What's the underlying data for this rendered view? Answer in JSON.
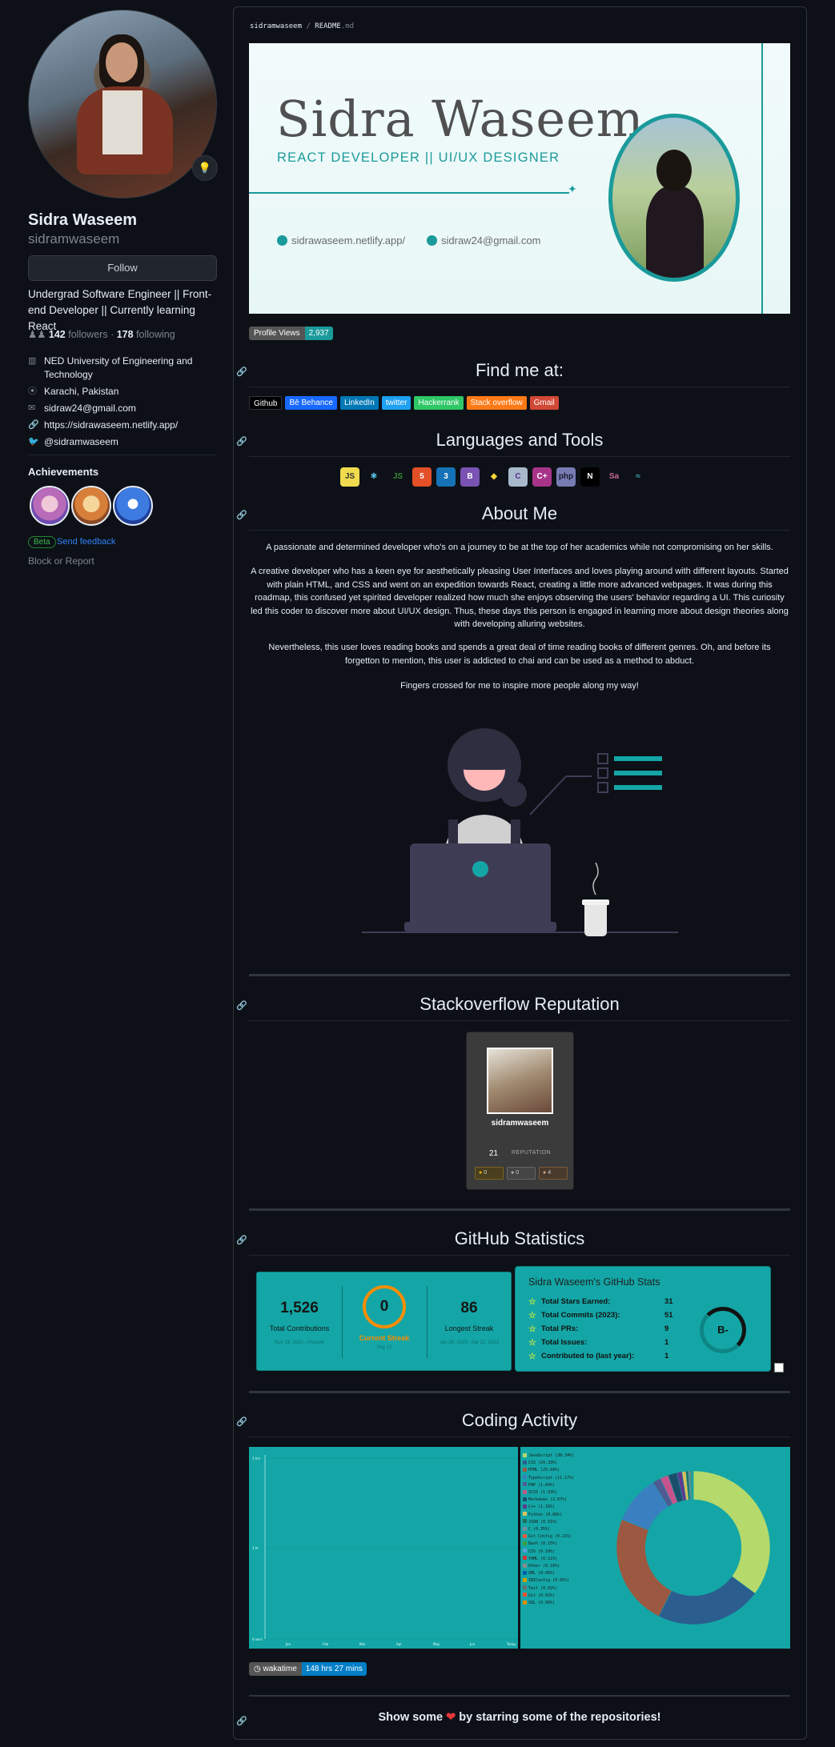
{
  "profile": {
    "name": "Sidra Waseem",
    "login": "sidramwaseem",
    "status_emoji": "💡",
    "follow_label": "Follow",
    "bio": "Undergrad Software Engineer || Front-end Developer || Currently learning React",
    "followers": "142",
    "followers_label": "followers",
    "following": "178",
    "following_label": "following",
    "separator": "·",
    "info": [
      {
        "icon": "building-icon",
        "glyph": "▥",
        "text": "NED University of Engineering and Technology"
      },
      {
        "icon": "location-icon",
        "glyph": "⦿",
        "text": "Karachi, Pakistan"
      },
      {
        "icon": "mail-icon",
        "glyph": "✉",
        "text": "sidraw24@gmail.com"
      },
      {
        "icon": "link-icon",
        "glyph": "🔗",
        "text": "https://sidrawaseem.netlify.app/"
      },
      {
        "icon": "twitter-icon",
        "glyph": "🐦",
        "text": "@sidramwaseem"
      }
    ],
    "achievements_title": "Achievements",
    "beta_label": "Beta",
    "feedback_label": "Send feedback",
    "block_label": "Block or Report"
  },
  "readme": {
    "path_user": "sidramwaseem",
    "path_sep": "/",
    "path_file": "README",
    "path_ext": ".md",
    "banner": {
      "name": "Sidra Waseem",
      "role": "REACT DEVELOPER || UI/UX DESIGNER",
      "website": "sidrawaseem.netlify.app/",
      "email": "sidraw24@gmail.com"
    },
    "views_label": "Profile Views",
    "views_value": "2,937",
    "find_me": "Find me at:",
    "socials": [
      {
        "label": "Github",
        "color": "#000000",
        "icon": "github-icon"
      },
      {
        "label": "Bē Behance",
        "color": "#1769ff",
        "icon": "behance-icon"
      },
      {
        "label": "LinkedIn",
        "color": "#0077b5",
        "icon": "linkedin-icon"
      },
      {
        "label": "twitter",
        "color": "#1da1f2",
        "icon": "twitter-icon"
      },
      {
        "label": "Hackerrank",
        "color": "#2ec866",
        "icon": "hackerrank-icon"
      },
      {
        "label": "Stack overflow",
        "color": "#fe7a16",
        "icon": "stackoverflow-icon"
      },
      {
        "label": "Gmail",
        "color": "#d14836",
        "icon": "gmail-icon"
      }
    ],
    "languages_title": "Languages and Tools",
    "tools": [
      {
        "icon": "javascript-icon",
        "glyph": "JS",
        "bg": "#f0db4f",
        "fg": "#323330"
      },
      {
        "icon": "react-icon",
        "glyph": "⚛",
        "bg": "#0d1117",
        "fg": "#61dafb"
      },
      {
        "icon": "nodejs-icon",
        "glyph": "JS",
        "bg": "#0d1117",
        "fg": "#3c873a"
      },
      {
        "icon": "html5-icon",
        "glyph": "5",
        "bg": "#e34f26",
        "fg": "#ffffff"
      },
      {
        "icon": "css3-icon",
        "glyph": "3",
        "bg": "#1572b6",
        "fg": "#ffffff"
      },
      {
        "icon": "bootstrap-icon",
        "glyph": "B",
        "bg": "#7952b3",
        "fg": "#ffffff"
      },
      {
        "icon": "python-icon",
        "glyph": "◆",
        "bg": "#0d1117",
        "fg": "#ffd43b"
      },
      {
        "icon": "c-icon",
        "glyph": "C",
        "bg": "#a8b9cc",
        "fg": "#5c2d91"
      },
      {
        "icon": "cplusplus-icon",
        "glyph": "C+",
        "bg": "#a8348a",
        "fg": "#ffffff"
      },
      {
        "icon": "php-icon",
        "glyph": "php",
        "bg": "#777bb4",
        "fg": "#1a1a2e"
      },
      {
        "icon": "nextjs-icon",
        "glyph": "N",
        "bg": "#000000",
        "fg": "#ffffff"
      },
      {
        "icon": "sass-icon",
        "glyph": "Sa",
        "bg": "#0d1117",
        "fg": "#cc6699"
      },
      {
        "icon": "tailwind-icon",
        "glyph": "≈",
        "bg": "#0d1117",
        "fg": "#38b2ac"
      }
    ],
    "about_title": "About Me",
    "about": [
      "A passionate and determined developer who's on a journey to be at the top of her academics while not compromising on her skills.",
      "A creative developer who has a keen eye for aesthetically pleasing User Interfaces and loves playing around with different layouts. Started with plain HTML, and CSS and went on an expedition towards React, creating a little more advanced webpages. It was during this roadmap, this confused yet spirited developer realized how much she enjoys observing the users' behavior regarding a UI. This curiosity led this coder to discover more about UI/UX design. Thus, these days this person is engaged in learning more about design theories along with developing alluring websites.",
      "Nevertheless, this user loves reading books and spends a great deal of time reading books of different genres. Oh, and before its forgetton to mention, this user is addicted to chai and can be used as a method to abduct.",
      "Fingers crossed for me to inspire more people along my way!"
    ],
    "stackoverflow_title": "Stackoverflow Reputation",
    "stackoverflow": {
      "user": "sidramwaseem",
      "reputation": "21",
      "reputation_label": "REPUTATION",
      "gold": "0",
      "silver": "0",
      "bronze": "4",
      "badge_glyph": "●"
    },
    "github_title": "GitHub Statistics",
    "streak": {
      "total": "1,526",
      "total_label": "Total Contributions",
      "total_range": "Nov 15, 2020 - Present",
      "current": "0",
      "current_label": "Current Streak",
      "current_range": "Sep 12",
      "longest": "86",
      "longest_label": "Longest Streak",
      "longest_range": "Jan 26, 2023 - Apr 21, 2023"
    },
    "gh_stats": {
      "title": "Sidra Waseem's GitHub Stats",
      "rows": [
        {
          "label": "Total Stars Earned:",
          "value": "31"
        },
        {
          "label": "Total Commits (2023):",
          "value": "51"
        },
        {
          "label": "Total PRs:",
          "value": "9"
        },
        {
          "label": "Total Issues:",
          "value": "1"
        },
        {
          "label": "Contributed to (last year):",
          "value": "1"
        }
      ],
      "grade": "B-",
      "grade_progress": 0.3
    },
    "coding_title": "Coding Activity",
    "coding_chart": {
      "y_ticks": [
        "1 hrs",
        "1 hr",
        "0 secs"
      ],
      "x_ticks": [
        "Jan",
        "Feb",
        "Mar",
        "Apr",
        "May",
        "Jun",
        "Today"
      ]
    },
    "languages_legend": [
      {
        "label": "JavaScript (38.34%)",
        "value": 38.34,
        "color": "#b5d96a"
      },
      {
        "label": "CSS (24.33%)",
        "value": 24.33,
        "color": "#2b5d8f"
      },
      {
        "label": "HTML (25.69%)",
        "value": 25.69,
        "color": "#9c5840"
      },
      {
        "label": "TypeScript (11.17%)",
        "value": 11.17,
        "color": "#3a7fbf"
      },
      {
        "label": "PHP (1.84%)",
        "value": 1.84,
        "color": "#4f5b93"
      },
      {
        "label": "SCSS (1.93%)",
        "value": 1.93,
        "color": "#c6538c"
      },
      {
        "label": "Markdown (2.07%)",
        "value": 2.07,
        "color": "#1a4f6b"
      },
      {
        "label": "C++ (1.16%)",
        "value": 1.16,
        "color": "#5e3a8f"
      },
      {
        "label": "Python (0.89%)",
        "value": 0.89,
        "color": "#d9c15b"
      },
      {
        "label": "JSON (0.51%)",
        "value": 0.51,
        "color": "#1f6e5e"
      },
      {
        "label": "C (0.35%)",
        "value": 0.35,
        "color": "#7a8b9c"
      },
      {
        "label": "Git Config (0.21%)",
        "value": 0.21,
        "color": "#e05d44"
      },
      {
        "label": "Bash (0.15%)",
        "value": 0.15,
        "color": "#3c9c3c"
      },
      {
        "label": "CSS (0.10%)",
        "value": 0.1,
        "color": "#5a9fd6"
      },
      {
        "label": "YAML (0.11%)",
        "value": 0.11,
        "color": "#cb3837"
      },
      {
        "label": "Other (0.10%)",
        "value": 0.1,
        "color": "#8a8a8a"
      },
      {
        "label": "XML (0.06%)",
        "value": 0.06,
        "color": "#0060ac"
      },
      {
        "label": "INIConfig (0.05%)",
        "value": 0.05,
        "color": "#d1a000"
      },
      {
        "label": "Text (0.02%)",
        "value": 0.02,
        "color": "#6c6c6c"
      },
      {
        "label": "Git (0.02%)",
        "value": 0.02,
        "color": "#f05032"
      },
      {
        "label": "SQL (0.00%)",
        "value": 0.0,
        "color": "#e38c00"
      }
    ],
    "wakatime_label": "wakatime",
    "wakatime_value": "148 hrs 27 mins",
    "footer_pre": "Show some",
    "footer_heart": "❤",
    "footer_post": "by starring some of the repositories!",
    "anchor_glyph": "🔗"
  }
}
